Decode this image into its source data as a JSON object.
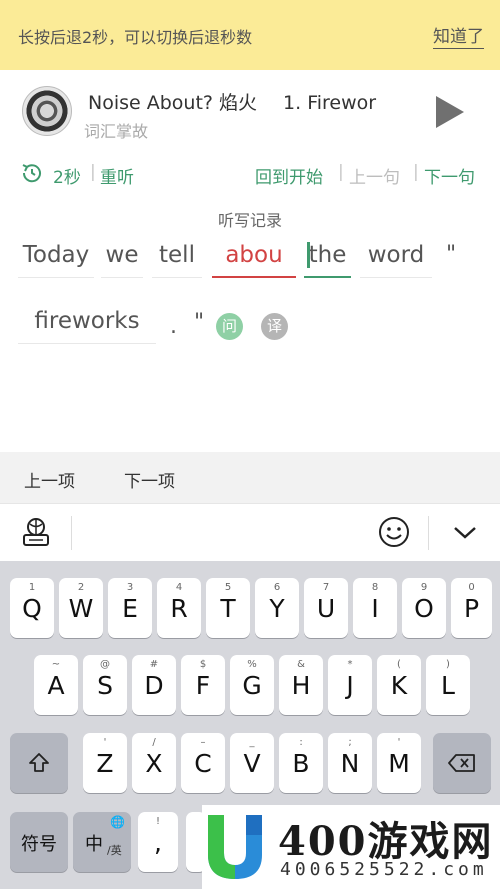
{
  "tip": {
    "text": "长按后退2秒，可以切换后退秒数",
    "button": "知道了"
  },
  "player": {
    "title": "Noise About? 焰火",
    "episode": "1. Firewor",
    "subtitle": "词汇掌故"
  },
  "controls": {
    "rewind": "2秒",
    "relisten": "重听",
    "to_start": "回到开始",
    "prev_sentence": "上一句",
    "next_sentence": "下一句"
  },
  "record_label": "听写记录",
  "dictation": {
    "words": [
      "Today",
      "we",
      "tell",
      "abou",
      "the",
      "word",
      "fireworks"
    ],
    "quote_open": "\"",
    "period": ".",
    "quote_close": "\"",
    "ask_badge": "问",
    "translate_badge": "译"
  },
  "nav": {
    "prev_item": "上一项",
    "next_item": "下一项"
  },
  "keyboard": {
    "row1": [
      {
        "sup": "1",
        "key": "Q"
      },
      {
        "sup": "2",
        "key": "W"
      },
      {
        "sup": "3",
        "key": "E"
      },
      {
        "sup": "4",
        "key": "R"
      },
      {
        "sup": "5",
        "key": "T"
      },
      {
        "sup": "6",
        "key": "Y"
      },
      {
        "sup": "7",
        "key": "U"
      },
      {
        "sup": "8",
        "key": "I"
      },
      {
        "sup": "9",
        "key": "O"
      },
      {
        "sup": "0",
        "key": "P"
      }
    ],
    "row2": [
      {
        "sup": "~",
        "key": "A"
      },
      {
        "sup": "@",
        "key": "S"
      },
      {
        "sup": "#",
        "key": "D"
      },
      {
        "sup": "$",
        "key": "F"
      },
      {
        "sup": "%",
        "key": "G"
      },
      {
        "sup": "&",
        "key": "H"
      },
      {
        "sup": "*",
        "key": "J"
      },
      {
        "sup": "(",
        "key": "K"
      },
      {
        "sup": ")",
        "key": "L"
      }
    ],
    "row3": [
      {
        "sup": "'",
        "key": "Z"
      },
      {
        "sup": "/",
        "key": "X"
      },
      {
        "sup": "–",
        "key": "C"
      },
      {
        "sup": "_",
        "key": "V"
      },
      {
        "sup": ":",
        "key": "B"
      },
      {
        "sup": ";",
        "key": "N"
      },
      {
        "sup": "'",
        "key": "M"
      }
    ],
    "symbols": "符号",
    "lang": "中",
    "lang_sub": "/英",
    "comma": ",",
    "comma_sup": "!"
  },
  "watermark": {
    "brand": "400游戏网",
    "phone": "4006525522.com"
  },
  "colors": {
    "accent": "#3f9a6e",
    "error": "#d24343",
    "tipbar": "#fbeb97"
  }
}
